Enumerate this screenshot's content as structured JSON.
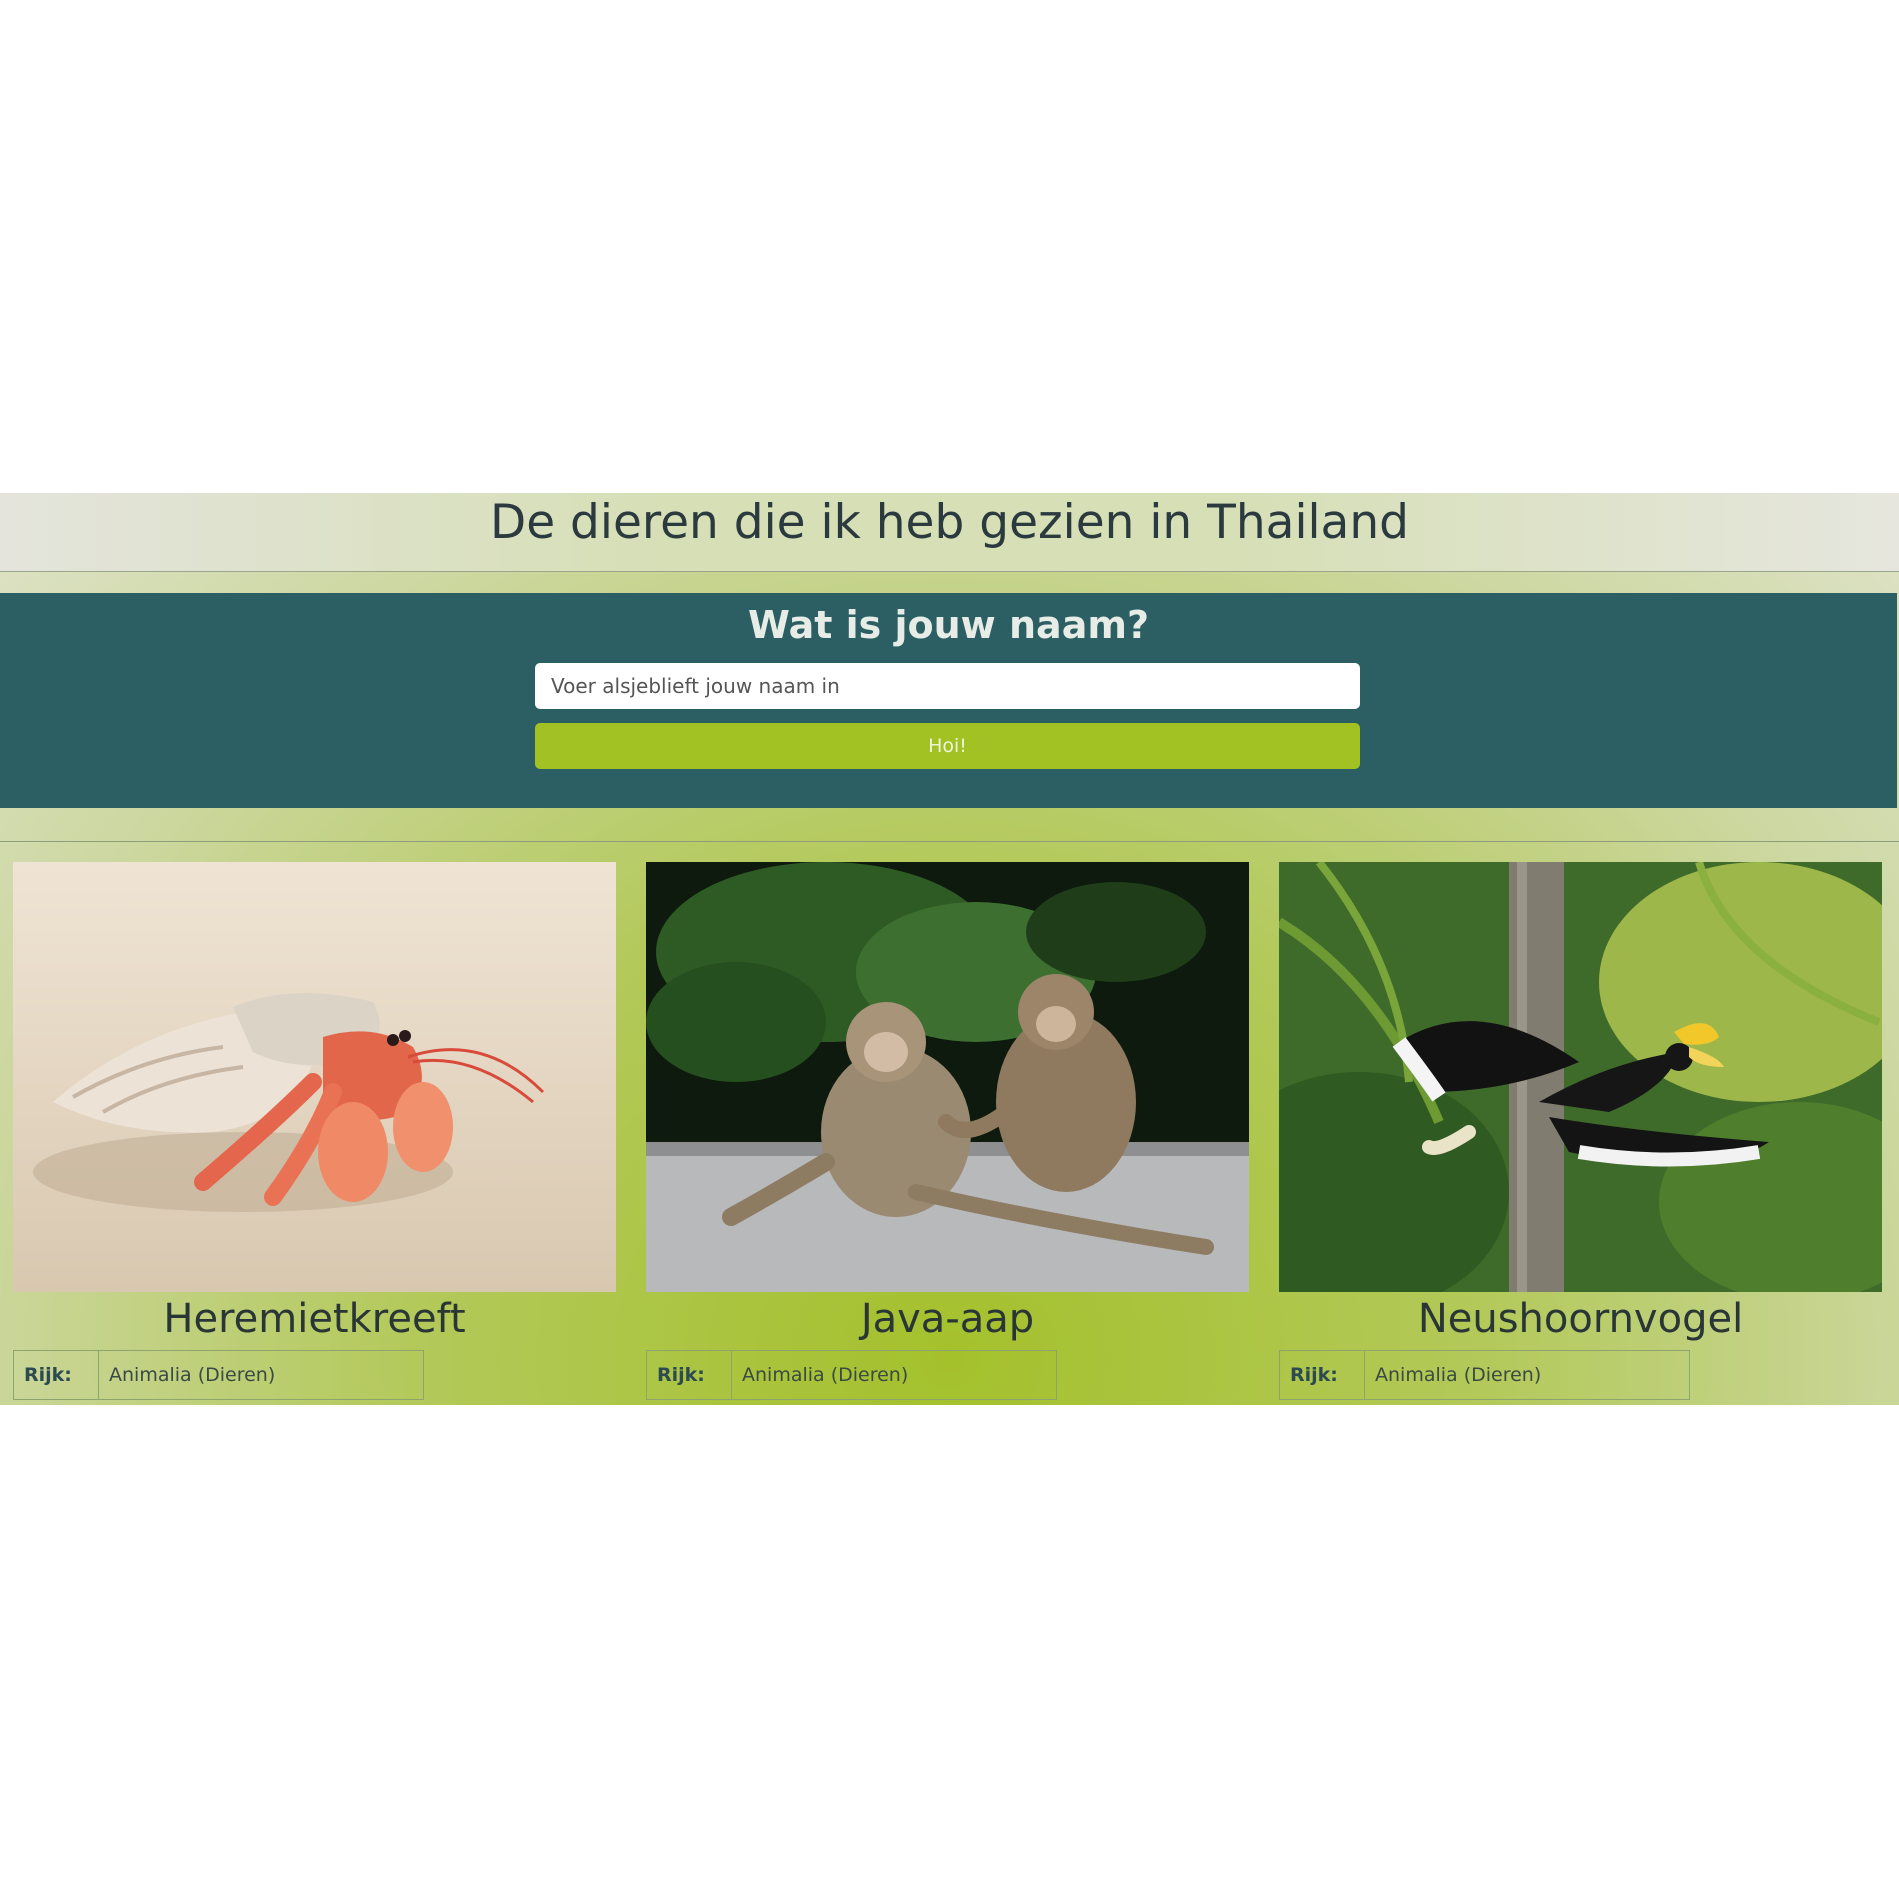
{
  "header": {
    "title": "De dieren die ik heb gezien in Thailand"
  },
  "greeting": {
    "heading": "Wat is jouw naam?",
    "input_placeholder": "Voer alsjeblieft jouw naam in",
    "button_label": "Hoi!"
  },
  "animals": [
    {
      "name": "Heremietkreeft",
      "info_key": "Rijk:",
      "info_value": "Animalia (Dieren)"
    },
    {
      "name": "Java-aap",
      "info_key": "Rijk:",
      "info_value": "Animalia (Dieren)"
    },
    {
      "name": "Neushoornvogel",
      "info_key": "Rijk:",
      "info_value": "Animalia (Dieren)"
    }
  ],
  "colors": {
    "header_text": "#2a3a3e",
    "form_background": "#2c5f64",
    "button": "#a2c224",
    "page_gradient_center": "#a4c12c"
  }
}
